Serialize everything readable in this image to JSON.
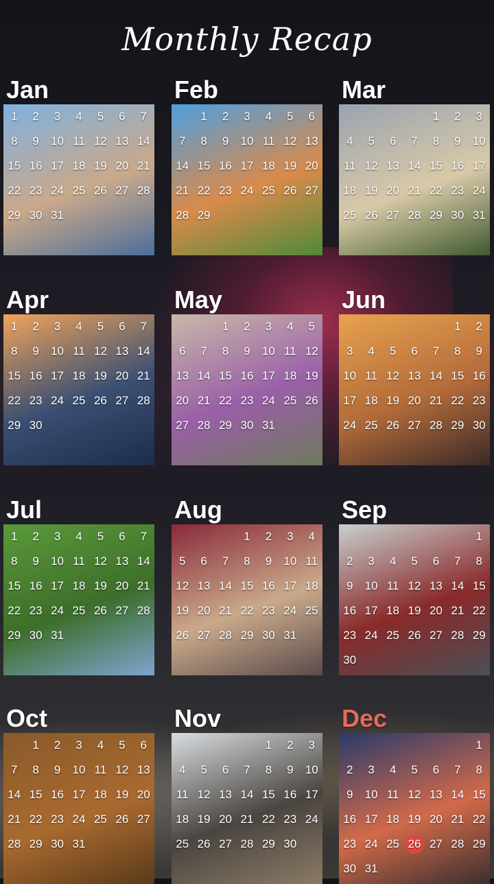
{
  "title": "Monthly Recap",
  "accent_color": "#e46a5b",
  "months": [
    {
      "label": "Jan",
      "offset": 0,
      "days": 31,
      "colors": [
        "#7fb1e0",
        "#c9a98a",
        "#4b6e9a"
      ]
    },
    {
      "label": "Feb",
      "offset": 1,
      "days": 29,
      "colors": [
        "#4f9fe0",
        "#d98a4a",
        "#4f8a3a"
      ]
    },
    {
      "label": "Mar",
      "offset": 4,
      "days": 31,
      "colors": [
        "#9aa3b0",
        "#d8c9a8",
        "#3f5a2f"
      ]
    },
    {
      "label": "Apr",
      "offset": 0,
      "days": 30,
      "colors": [
        "#f0a45a",
        "#3b4f73",
        "#1d2c4a"
      ]
    },
    {
      "label": "May",
      "offset": 2,
      "days": 31,
      "colors": [
        "#c9b8a8",
        "#9a5fa8",
        "#6d7a5a"
      ]
    },
    {
      "label": "Jun",
      "offset": 5,
      "days": 30,
      "colors": [
        "#e8a24e",
        "#b36b3a",
        "#3a2a28"
      ]
    },
    {
      "label": "Jul",
      "offset": 0,
      "days": 31,
      "colors": [
        "#5a9a3a",
        "#3d6e2a",
        "#7da4d0"
      ]
    },
    {
      "label": "Aug",
      "offset": 3,
      "days": 31,
      "colors": [
        "#8a2a3a",
        "#c9a98a",
        "#5a4a4a"
      ]
    },
    {
      "label": "Sep",
      "offset": 6,
      "days": 30,
      "colors": [
        "#c9cfcf",
        "#8a2a2a",
        "#4a4f55"
      ]
    },
    {
      "label": "Oct",
      "offset": 1,
      "days": 31,
      "colors": [
        "#8a5a2a",
        "#a96a2f",
        "#5a3a1a"
      ]
    },
    {
      "label": "Nov",
      "offset": 4,
      "days": 30,
      "colors": [
        "#d9dde0",
        "#4a4540",
        "#8a7a65"
      ]
    },
    {
      "label": "Dec",
      "offset": 6,
      "days": 31,
      "colors": [
        "#2a3a6a",
        "#d26a4a",
        "#3a2f2f"
      ],
      "accent": true,
      "highlight": 26
    }
  ]
}
